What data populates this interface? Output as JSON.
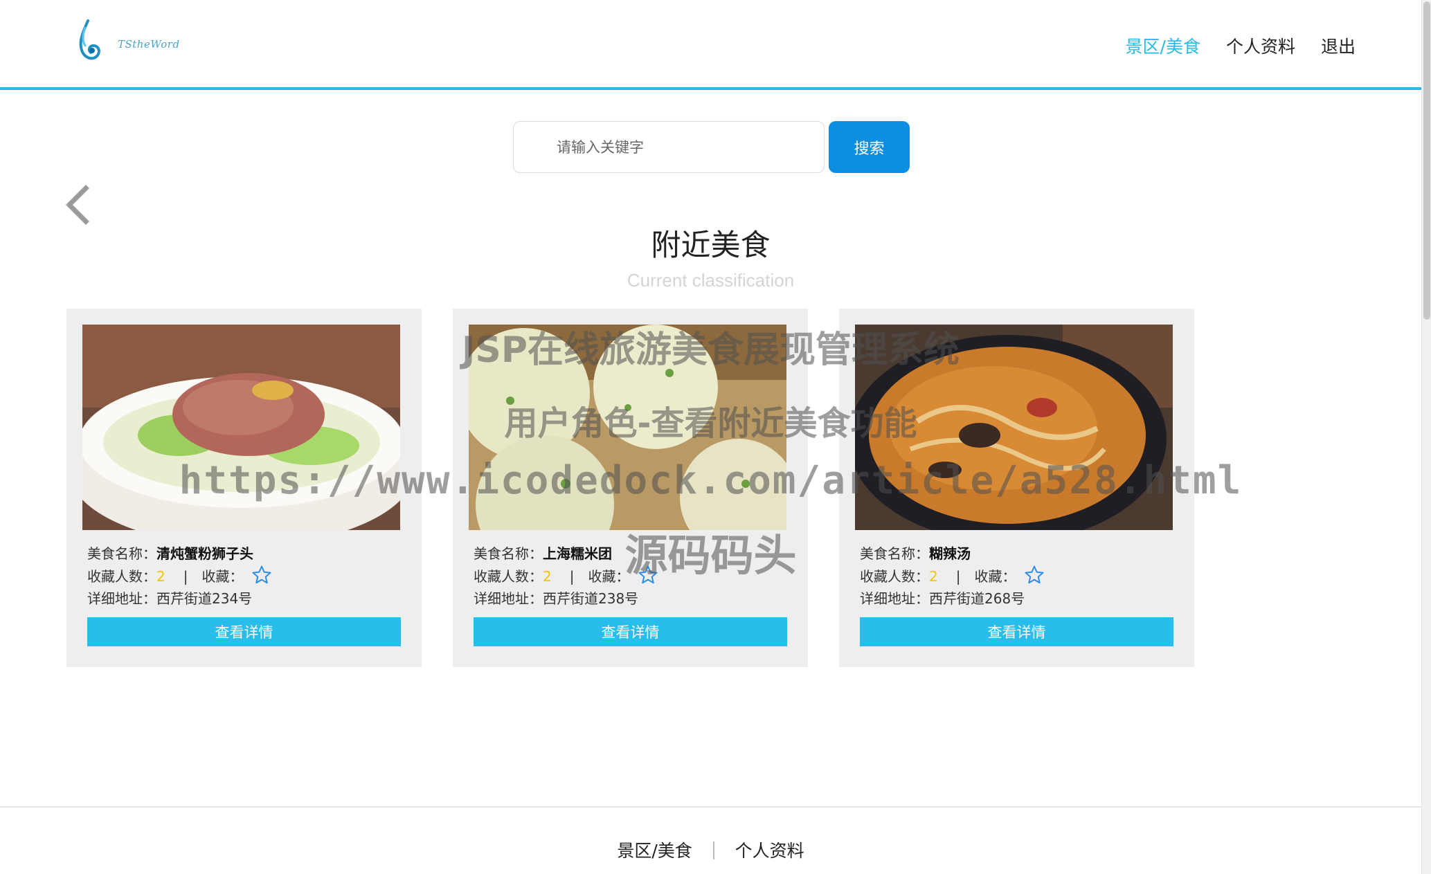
{
  "header": {
    "logo_text": "TStheWord",
    "nav": [
      {
        "label": "景区/美食",
        "active": true
      },
      {
        "label": "个人资料",
        "active": false
      },
      {
        "label": "退出",
        "active": false
      }
    ]
  },
  "search": {
    "placeholder": "请输入关键字",
    "value": "",
    "button_label": "搜索"
  },
  "section": {
    "title": "附近美食",
    "subtitle": "Current classification"
  },
  "labels": {
    "name": "美食名称：",
    "collect_count": "收藏人数：",
    "divider": "|",
    "collect": "收藏：",
    "address": "详细地址：",
    "detail_button": "查看详情"
  },
  "foods": [
    {
      "name": "清炖蟹粉狮子头",
      "collect_count": "2",
      "address": "西芹街道234号",
      "image_icon": "lion-head-meatball-photo"
    },
    {
      "name": "上海糯米团",
      "collect_count": "2",
      "address": "西芹街道238号",
      "image_icon": "glutinous-rice-ball-photo"
    },
    {
      "name": "糊辣汤",
      "collect_count": "2",
      "address": "西芹街道268号",
      "image_icon": "hot-pepper-soup-photo"
    }
  ],
  "watermark": {
    "line1": "JSP在线旅游美食展现管理系统",
    "line2": "用户角色-查看附近美食功能",
    "line3": "https://www.icodedock.com/article/a528.html",
    "line4": "源码码头"
  },
  "footer": {
    "nav": [
      "景区/美食",
      "个人资料"
    ]
  },
  "colors": {
    "accent": "#29b8e8",
    "search_button": "#0d8ee0",
    "detail_button": "#29bdec",
    "count": "#f5c300",
    "card_bg": "#eeeeee"
  }
}
